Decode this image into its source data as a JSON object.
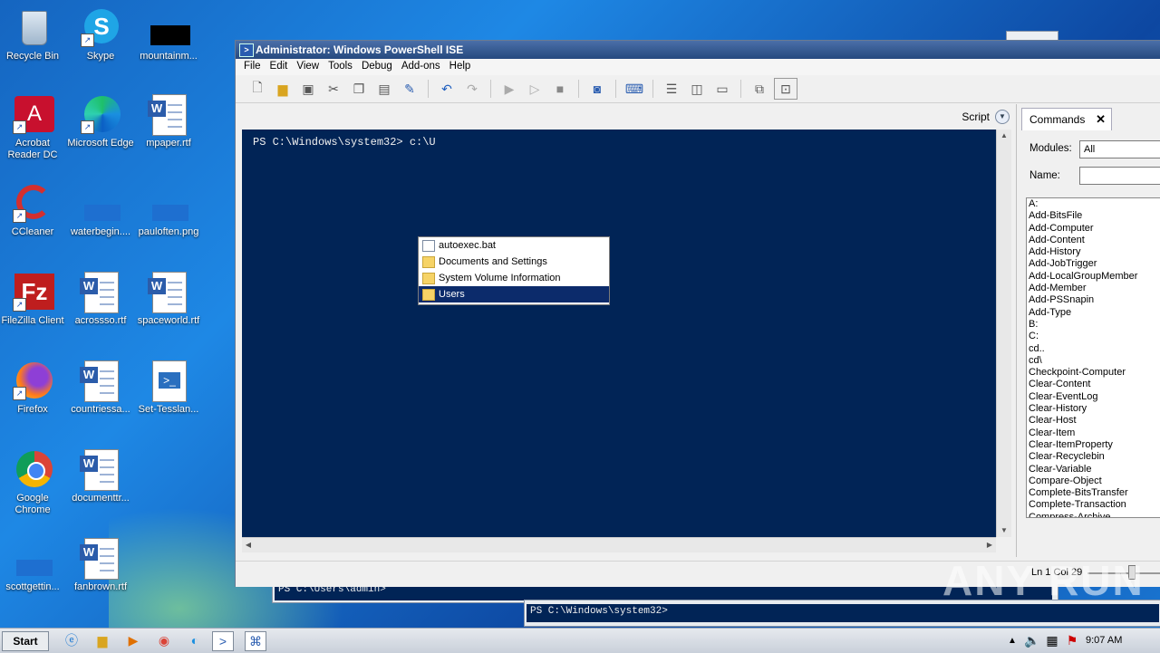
{
  "desktop": {
    "icons": [
      {
        "label": "Recycle Bin"
      },
      {
        "label": "Skype"
      },
      {
        "label": "mountainm..."
      },
      {
        "label": "Acrobat Reader DC"
      },
      {
        "label": "Microsoft Edge"
      },
      {
        "label": "mpaper.rtf"
      },
      {
        "label": "CCleaner"
      },
      {
        "label": "waterbegin...."
      },
      {
        "label": "pauloften.png"
      },
      {
        "label": "FileZilla Client"
      },
      {
        "label": "acrossso.rtf"
      },
      {
        "label": "spaceworld.rtf"
      },
      {
        "label": "Firefox"
      },
      {
        "label": "countriessa..."
      },
      {
        "label": "Set-Tesslan..."
      },
      {
        "label": "Google Chrome"
      },
      {
        "label": "documenttr..."
      },
      {
        "label": "scottgettin..."
      },
      {
        "label": "fanbrown.rtf"
      }
    ]
  },
  "bg_consoles": {
    "first": "PS C:\\Users\\admin>",
    "second": "PS C:\\Windows\\system32>"
  },
  "ise": {
    "title": "Administrator: Windows PowerShell ISE",
    "menu": [
      "File",
      "Edit",
      "View",
      "Tools",
      "Debug",
      "Add-ons",
      "Help"
    ],
    "script_label": "Script",
    "prompt": "PS C:\\Windows\\system32> c:\\U",
    "completion": [
      {
        "label": "autoexec.bat",
        "kind": "file",
        "selected": false
      },
      {
        "label": "Documents and Settings",
        "kind": "folder",
        "selected": false
      },
      {
        "label": "System Volume Information",
        "kind": "folder",
        "selected": false
      },
      {
        "label": "Users",
        "kind": "folder",
        "selected": true
      }
    ],
    "status": "Ln 1  Col 29"
  },
  "commands": {
    "tab_label": "Commands",
    "modules_label": "Modules:",
    "modules_value": "All",
    "name_label": "Name:",
    "name_value": "",
    "list": [
      "A:",
      "Add-BitsFile",
      "Add-Computer",
      "Add-Content",
      "Add-History",
      "Add-JobTrigger",
      "Add-LocalGroupMember",
      "Add-Member",
      "Add-PSSnapin",
      "Add-Type",
      "B:",
      "C:",
      "cd..",
      "cd\\",
      "Checkpoint-Computer",
      "Clear-Content",
      "Clear-EventLog",
      "Clear-History",
      "Clear-Host",
      "Clear-Item",
      "Clear-ItemProperty",
      "Clear-Recyclebin",
      "Clear-Variable",
      "Compare-Object",
      "Complete-BitsTransfer",
      "Complete-Transaction",
      "Compress-Archive"
    ]
  },
  "taskbar": {
    "start_label": "Start",
    "clock": "9:07 AM"
  },
  "watermark": "ANY RUN"
}
